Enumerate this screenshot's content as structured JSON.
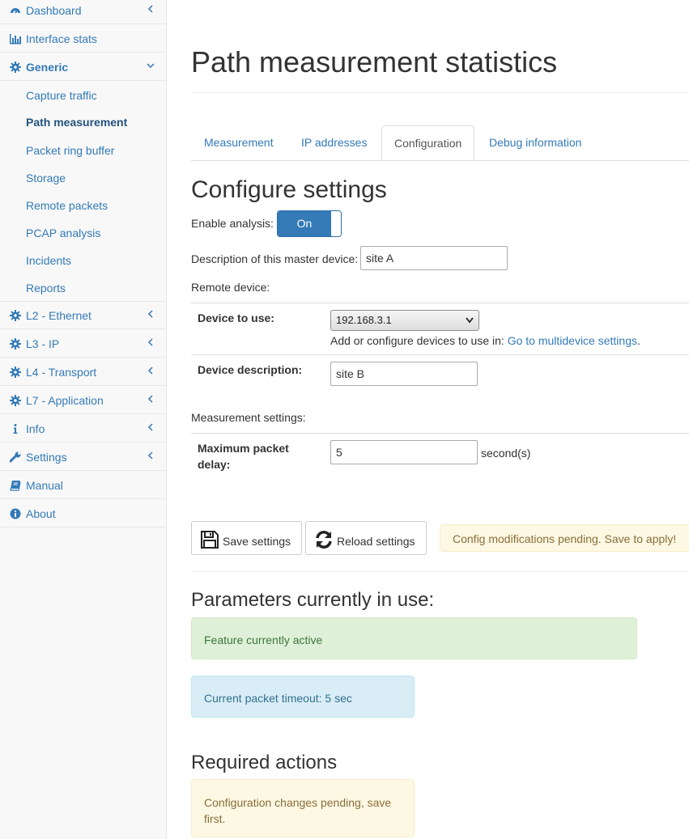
{
  "sidebar": {
    "items": [
      {
        "id": "dashboard",
        "label": "Dashboard",
        "icon": "dashboard-icon",
        "chevron": "left"
      },
      {
        "id": "interface-stats",
        "label": "Interface stats",
        "icon": "bar-chart-icon",
        "chevron": ""
      },
      {
        "id": "generic",
        "label": "Generic",
        "icon": "gear-icon",
        "chevron": "down",
        "expanded": true
      },
      {
        "id": "l2",
        "label": "L2 - Ethernet",
        "icon": "gear-icon",
        "chevron": "left"
      },
      {
        "id": "l3",
        "label": "L3 - IP",
        "icon": "gear-icon",
        "chevron": "left"
      },
      {
        "id": "l4",
        "label": "L4 - Transport",
        "icon": "gear-icon",
        "chevron": "left"
      },
      {
        "id": "l7",
        "label": "L7 - Application",
        "icon": "gear-icon",
        "chevron": "left"
      },
      {
        "id": "info",
        "label": "Info",
        "icon": "info-icon",
        "chevron": "left"
      },
      {
        "id": "settings",
        "label": "Settings",
        "icon": "wrench-icon",
        "chevron": "left"
      },
      {
        "id": "manual",
        "label": "Manual",
        "icon": "book-icon",
        "chevron": ""
      },
      {
        "id": "about",
        "label": "About",
        "icon": "info-circle-icon",
        "chevron": ""
      }
    ],
    "generic_sub": [
      {
        "label": "Capture traffic",
        "active": false
      },
      {
        "label": "Path measurement",
        "active": true
      },
      {
        "label": "Packet ring buffer",
        "active": false
      },
      {
        "label": "Storage",
        "active": false
      },
      {
        "label": "Remote packets",
        "active": false
      },
      {
        "label": "PCAP analysis",
        "active": false
      },
      {
        "label": "Incidents",
        "active": false
      },
      {
        "label": "Reports",
        "active": false
      }
    ]
  },
  "main": {
    "title": "Path measurement statistics",
    "tabs": [
      {
        "label": "Measurement",
        "active": false
      },
      {
        "label": "IP addresses",
        "active": false
      },
      {
        "label": "Configuration",
        "active": true
      },
      {
        "label": "Debug information",
        "active": false
      }
    ],
    "configure": {
      "heading": "Configure settings",
      "enable_label": "Enable analysis:",
      "toggle_state": "On",
      "description_label": "Description of this master device:",
      "description_value": "site A",
      "remote_label": "Remote device:",
      "device_to_use_label": "Device to use:",
      "device_selected": "192.168.3.1",
      "devices_hint": "Add or configure devices to use in: ",
      "devices_link": "Go to multidevice settings",
      "devices_hint_end": ".",
      "device_description_label": "Device description:",
      "device_description_value": "site B",
      "measurement_label": "Measurement settings:",
      "max_delay_label_1": "Maximum packet",
      "max_delay_label_2": "delay:",
      "max_delay_value": "5",
      "max_delay_unit": "second(s)"
    },
    "actions": {
      "save_label": "Save settings",
      "reload_label": "Reload settings",
      "pending_notice": "Config modifications pending. Save to apply!"
    },
    "params": {
      "heading": "Parameters currently in use:",
      "active_notice": "Feature currently active",
      "timeout_notice": "Current packet timeout: 5 sec"
    },
    "required": {
      "heading": "Required actions",
      "notice_1": "Configuration changes pending, save",
      "notice_2": "first."
    }
  },
  "colors": {
    "link": "#337ab7",
    "primary": "#337ab7",
    "warning_bg": "#fcf8e3",
    "success_bg": "#dff0d8",
    "info_bg": "#d9edf7"
  }
}
